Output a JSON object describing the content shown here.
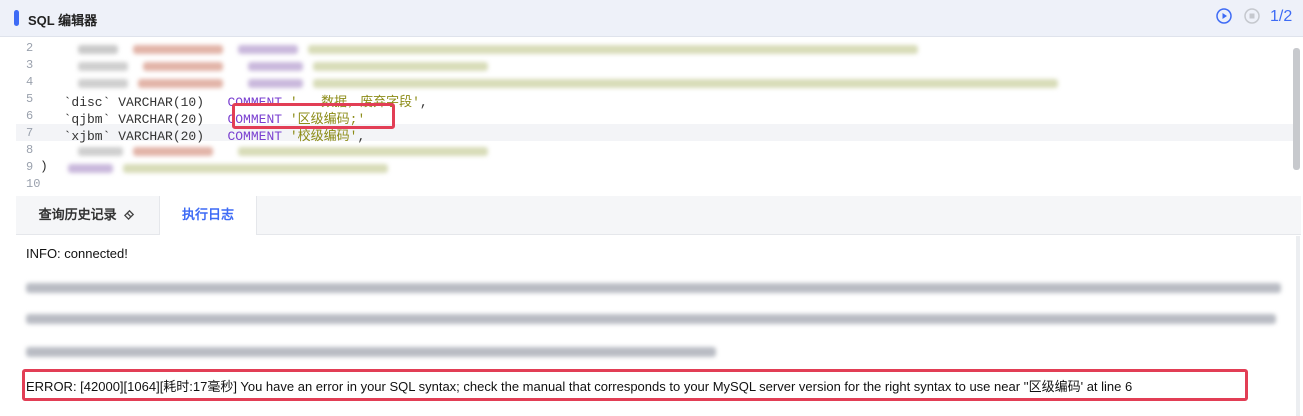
{
  "header": {
    "title": "SQL 编辑器",
    "page_indicator": "1/2",
    "accent_color": "#3e6bf5"
  },
  "editor": {
    "line_numbers": [
      "2",
      "3",
      "4",
      "5",
      "6",
      "7",
      "8",
      "9",
      "10"
    ],
    "lines": {
      "l5_plain": "  `disc` VARCHAR(10)",
      "l5_kw": "COMMENT",
      "l5_str": "'...数据，废弃字段'",
      "l6_plain": "  `qjbm` VARCHAR(20)",
      "l6_kw": "COMMENT",
      "l6_str": "'区级编码;'",
      "l7_plain": "  `xjbm` VARCHAR(20)",
      "l7_kw": "COMMENT",
      "l7_str": "'校级编码'",
      "l7_tail": ",",
      "l9": ")"
    }
  },
  "tabs": {
    "history_label": "查询历史记录",
    "history_icon": "eraser-icon",
    "log_label": "执行日志"
  },
  "log": {
    "info": "INFO: connected!",
    "error": "ERROR: [42000][1064][耗时:17毫秒] You have an error in your SQL syntax; check the manual that corresponds to your MySQL server version for the right syntax to use near ''区级编码' at line 6"
  },
  "colors": {
    "highlight": "#e23e55",
    "keyword": "#7a3fd0",
    "string": "#8c8c17"
  }
}
